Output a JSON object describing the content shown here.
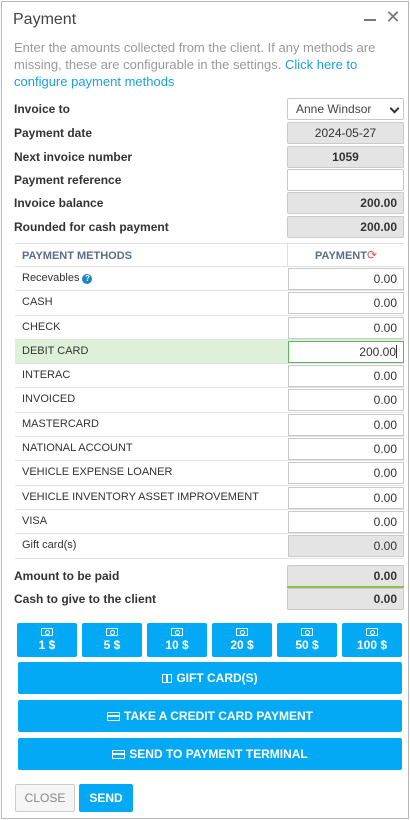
{
  "window": {
    "title": "Payment",
    "minimize_glyph": "—",
    "close_glyph": "✕"
  },
  "intro": {
    "text": "Enter the amounts collected from the client. If any methods are missing, these are configurable in the settings.",
    "link": "Click here to configure payment methods"
  },
  "form": {
    "invoice_to": {
      "label": "Invoice to",
      "value": "Anne Windsor"
    },
    "payment_date": {
      "label": "Payment date",
      "value": "2024-05-27"
    },
    "next_invoice_number": {
      "label": "Next invoice number",
      "value": "1059"
    },
    "payment_reference": {
      "label": "Payment reference",
      "value": ""
    },
    "invoice_balance": {
      "label": "Invoice balance",
      "value": "200.00"
    },
    "rounded_cash": {
      "label": "Rounded for cash payment",
      "value": "200.00"
    }
  },
  "table": {
    "header_methods": "PAYMENT METHODS",
    "header_payment": "PAYMENT",
    "rows": [
      {
        "label": "Recevables",
        "value": "0.00",
        "info": "?"
      },
      {
        "label": "CASH",
        "value": "0.00"
      },
      {
        "label": "CHECK",
        "value": "0.00"
      },
      {
        "label": "DEBIT CARD",
        "value": "200.00"
      },
      {
        "label": "INTERAC",
        "value": "0.00"
      },
      {
        "label": "INVOICED",
        "value": "0.00"
      },
      {
        "label": "MASTERCARD",
        "value": "0.00"
      },
      {
        "label": "NATIONAL ACCOUNT",
        "value": "0.00"
      },
      {
        "label": "VEHICLE EXPENSE LOANER",
        "value": "0.00"
      },
      {
        "label": "VEHICLE INVENTORY ASSET IMPROVEMENT",
        "value": "0.00"
      },
      {
        "label": "VISA",
        "value": "0.00"
      },
      {
        "label": "Gift card(s)",
        "value": "0.00"
      }
    ]
  },
  "summary": {
    "amount_to_pay": {
      "label": "Amount to be paid",
      "value": "0.00"
    },
    "cash_to_give": {
      "label": "Cash to give to the client",
      "value": "0.00"
    }
  },
  "cash_buttons": [
    "1 $",
    "5 $",
    "10 $",
    "20 $",
    "50 $",
    "100 $"
  ],
  "actions": {
    "gift_cards": "GIFT CARD(S)",
    "credit_card": "TAKE A CREDIT CARD PAYMENT",
    "terminal": "SEND TO PAYMENT TERMINAL"
  },
  "footer": {
    "close": "CLOSE",
    "send": "SEND"
  },
  "colors": {
    "accent": "#03a9f4",
    "active_row": "#dff0d8",
    "link": "#1aa0e0"
  }
}
